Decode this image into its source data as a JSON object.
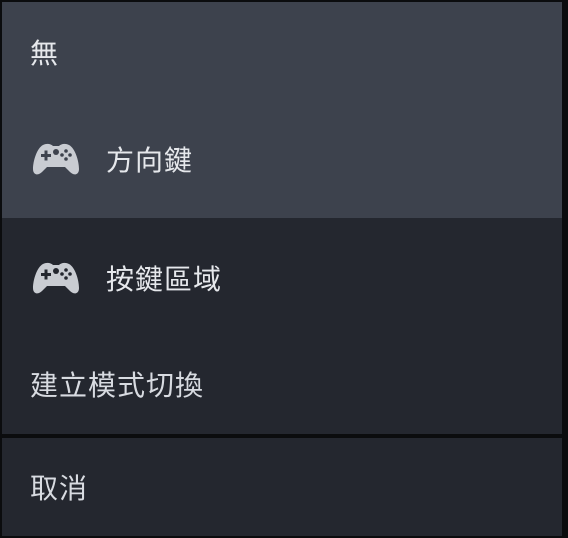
{
  "menu": {
    "items": [
      {
        "label": "無",
        "icon": null
      },
      {
        "label": "方向鍵",
        "icon": "gamepad-icon"
      },
      {
        "label": "按鍵區域",
        "icon": "gamepad-icon"
      },
      {
        "label": "建立模式切換",
        "icon": null
      }
    ],
    "cancel_label": "取消"
  },
  "colors": {
    "highlight": "#3d424d",
    "background": "#24272f",
    "text": "#e6e8ec",
    "icon": "#c9ccd2"
  }
}
